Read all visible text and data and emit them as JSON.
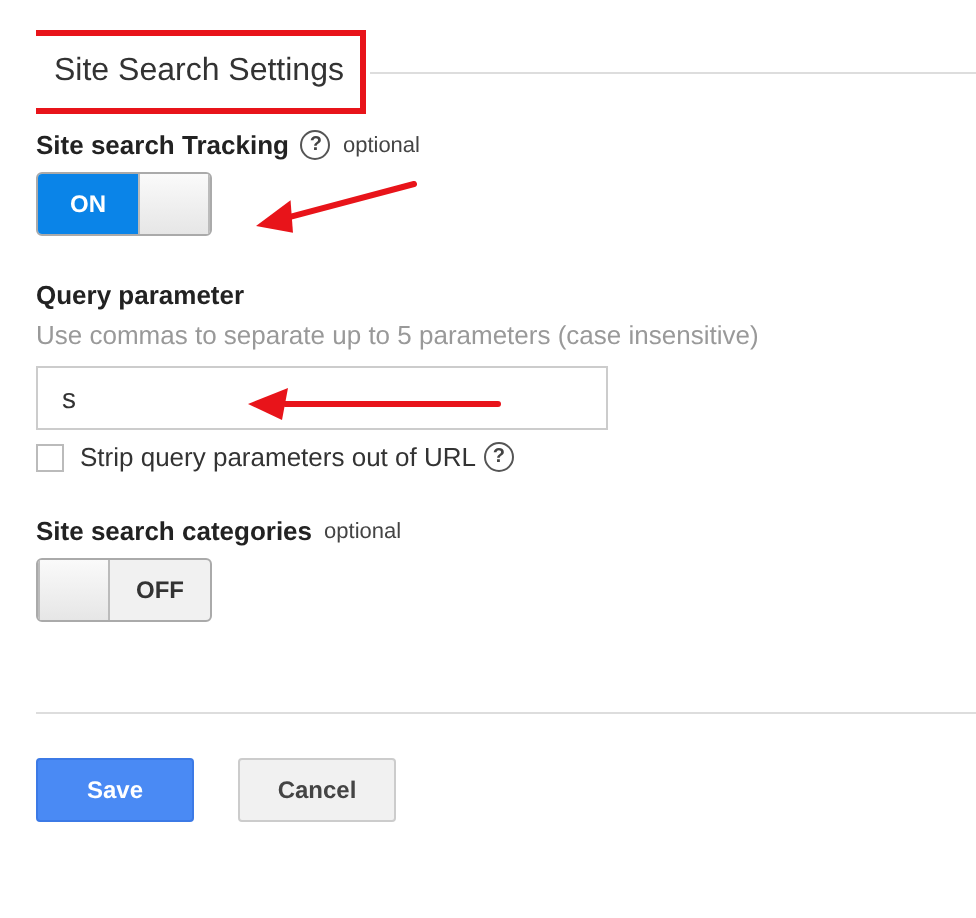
{
  "section": {
    "title": "Site Search Settings",
    "highlighted": true
  },
  "tracking": {
    "label": "Site search Tracking",
    "help": "?",
    "note": "optional",
    "toggle": {
      "on": true,
      "text": "ON"
    },
    "arrow": true
  },
  "query": {
    "label": "Query parameter",
    "hint": "Use commas to separate up to 5 parameters (case insensitive)",
    "value": "s",
    "arrow": true,
    "strip": {
      "label": "Strip query parameters out of URL",
      "help": "?",
      "checked": false
    }
  },
  "categories": {
    "label": "Site search categories",
    "note": "optional",
    "toggle": {
      "on": false,
      "text": "OFF"
    }
  },
  "buttons": [
    {
      "label": "Save",
      "kind": "primary"
    },
    {
      "label": "Cancel",
      "kind": "secondary"
    }
  ]
}
